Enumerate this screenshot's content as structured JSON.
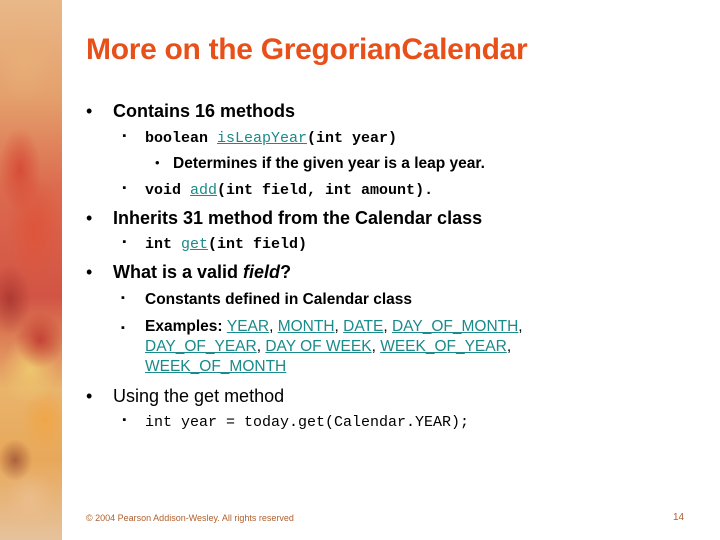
{
  "slide": {
    "title": "More on the GregorianCalendar",
    "title_color": "#e8501a",
    "link_color": "#1a8a8a",
    "bullets": {
      "b1": {
        "text": "Contains 16 methods",
        "sub1": {
          "prefix": "boolean ",
          "link": "isLeapYear",
          "suffix": "(int year)",
          "detail": "Determines if the given year is a leap year."
        },
        "sub2": {
          "prefix": "void ",
          "link": "add",
          "suffix": "(int field, int amount)."
        }
      },
      "b2": {
        "text": "Inherits 31 method from the Calendar class",
        "sub1": {
          "prefix": "int ",
          "link": "get",
          "suffix": "(int field)"
        }
      },
      "b3": {
        "text_before": "What is a valid ",
        "text_italic": "field",
        "text_after": "?",
        "sub1": {
          "text": "Constants defined in Calendar class"
        },
        "sub2": {
          "label": "Examples: ",
          "constants": [
            "YEAR",
            "MONTH",
            "DATE",
            "DAY_OF_MONTH",
            "DAY_OF_YEAR",
            "DAY OF WEEK",
            "WEEK_OF_YEAR",
            "WEEK_OF_MONTH"
          ],
          "separator": ", "
        }
      },
      "b4": {
        "text": "Using the get method",
        "sub1": {
          "code": "int year = today.get(Calendar.YEAR);"
        }
      }
    },
    "bullet_glyph": "•",
    "footer": {
      "copyright": "© 2004 Pearson Addison-Wesley. All rights reserved",
      "page_number": "14"
    }
  }
}
